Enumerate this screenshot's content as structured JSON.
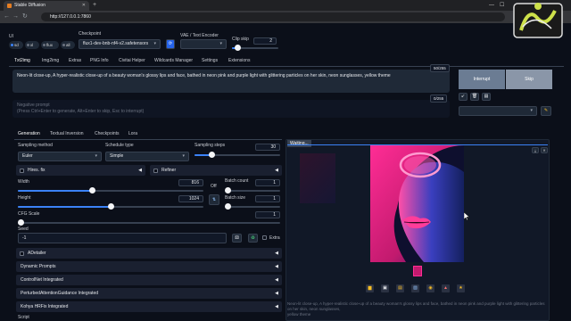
{
  "browser": {
    "tab_title": "Stable Diffusion",
    "url": "http://127.0.0.1:7860"
  },
  "header": {
    "ui_label": "UI",
    "ui_options": [
      "sd",
      "xl",
      "flux",
      "all"
    ],
    "ui_selected": "sd",
    "checkpoint_label": "Checkpoint",
    "checkpoint_value": "flux1-dev-bnb-nf4-v2.safetensors",
    "vae_label": "VAE / Text Encoder",
    "clip_skip_label": "Clip skip",
    "clip_skip_value": "2"
  },
  "main_tabs": [
    "Txt2img",
    "Img2img",
    "Extras",
    "PNG Info",
    "Civitai Helper",
    "Wildcards Manager",
    "Settings",
    "Extensions"
  ],
  "prompt": {
    "text": "Neon-lit close-up, A hyper-realistic close-up of a beauty woman's glossy lips and face, bathed in neon pink and purple light with glittering particles on her skin, neon sunglasses, yellow theme",
    "count": "50/255",
    "negative_placeholder_1": "Negative prompt",
    "negative_placeholder_2": "(Press Ctrl+Enter to generate, Alt+Enter to skip, Esc to interrupt)",
    "negative_count": "0/255"
  },
  "actions": {
    "interrupt": "Interrupt",
    "skip": "Skip"
  },
  "sub_tabs": [
    "Generation",
    "Textual Inversion",
    "Checkpoints",
    "Lora"
  ],
  "generation": {
    "sampling_method_label": "Sampling method",
    "sampling_method": "Euler",
    "schedule_type_label": "Schedule type",
    "schedule_type": "Simple",
    "sampling_steps_label": "Sampling steps",
    "sampling_steps": "30",
    "sampling_steps_fraction": 0.2,
    "hires_fix": "Hires. fix",
    "refiner": "Refiner",
    "width_label": "Width",
    "width": "816",
    "width_fraction": 0.4,
    "height_label": "Height",
    "height": "1024",
    "height_fraction": 0.5,
    "swap_label": "Off",
    "batch_count_label": "Batch count",
    "batch_count": "1",
    "batch_size_label": "Batch size",
    "batch_size": "1",
    "cfg_label": "CFG Scale",
    "cfg": "1",
    "seed_label": "Seed",
    "seed": "-1",
    "extra_label": "Extra"
  },
  "accordions": [
    "ADetailer",
    "Dynamic Prompts",
    "ControlNet Integrated",
    "PerturbedAttentionGuidance Integrated",
    "Kohya HRFix Integrated"
  ],
  "script_label": "Script",
  "output": {
    "status": "Waiting...",
    "caption_1": "Neon-lit close-up, A hyper-realistic close-up of a beauty woman's glossy lips and face, bathed in neon pink and purple light with glittering particles on her skin, neon sunglasses,",
    "caption_2": "yellow theme",
    "tool_icons": [
      "folder-icon",
      "save-icon",
      "zip-icon",
      "image-icon",
      "palette-icon",
      "extras-icon",
      "star-icon"
    ]
  },
  "colors": {
    "accent": "#3b82f6",
    "interrupt_bg": "#6b7c93",
    "skip_bg": "#8a96a8",
    "image_pink": "#ff2d95",
    "image_blue": "#1b2a8c"
  }
}
